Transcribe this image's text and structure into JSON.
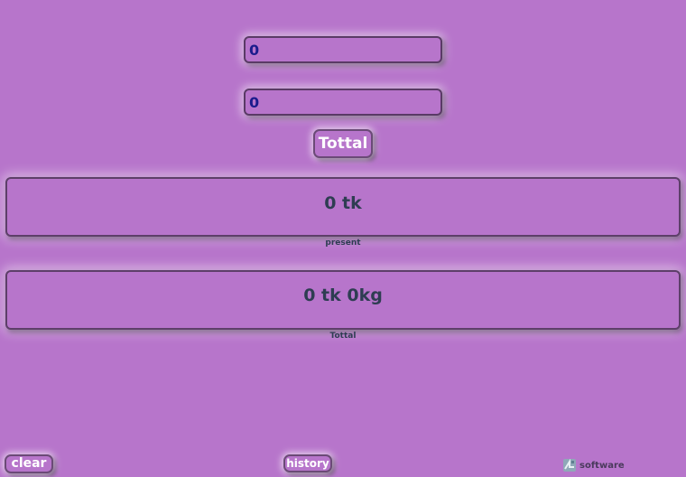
{
  "inputs": {
    "first": {
      "value": "0"
    },
    "second": {
      "value": "0"
    }
  },
  "buttons": {
    "total": "Tottal",
    "clear": "clear",
    "history": "history"
  },
  "results": {
    "present": {
      "value": "0 tk",
      "caption": "present"
    },
    "total": {
      "value": "0 tk 0kg",
      "caption": "Tottal"
    }
  },
  "footer": {
    "brand_text": "software",
    "brand_icon": "software-logo-icon"
  },
  "colors": {
    "background": "#b775cb",
    "input_text": "#1b1b8c",
    "result_text": "#2e3d52",
    "button_text": "#ffffff"
  }
}
